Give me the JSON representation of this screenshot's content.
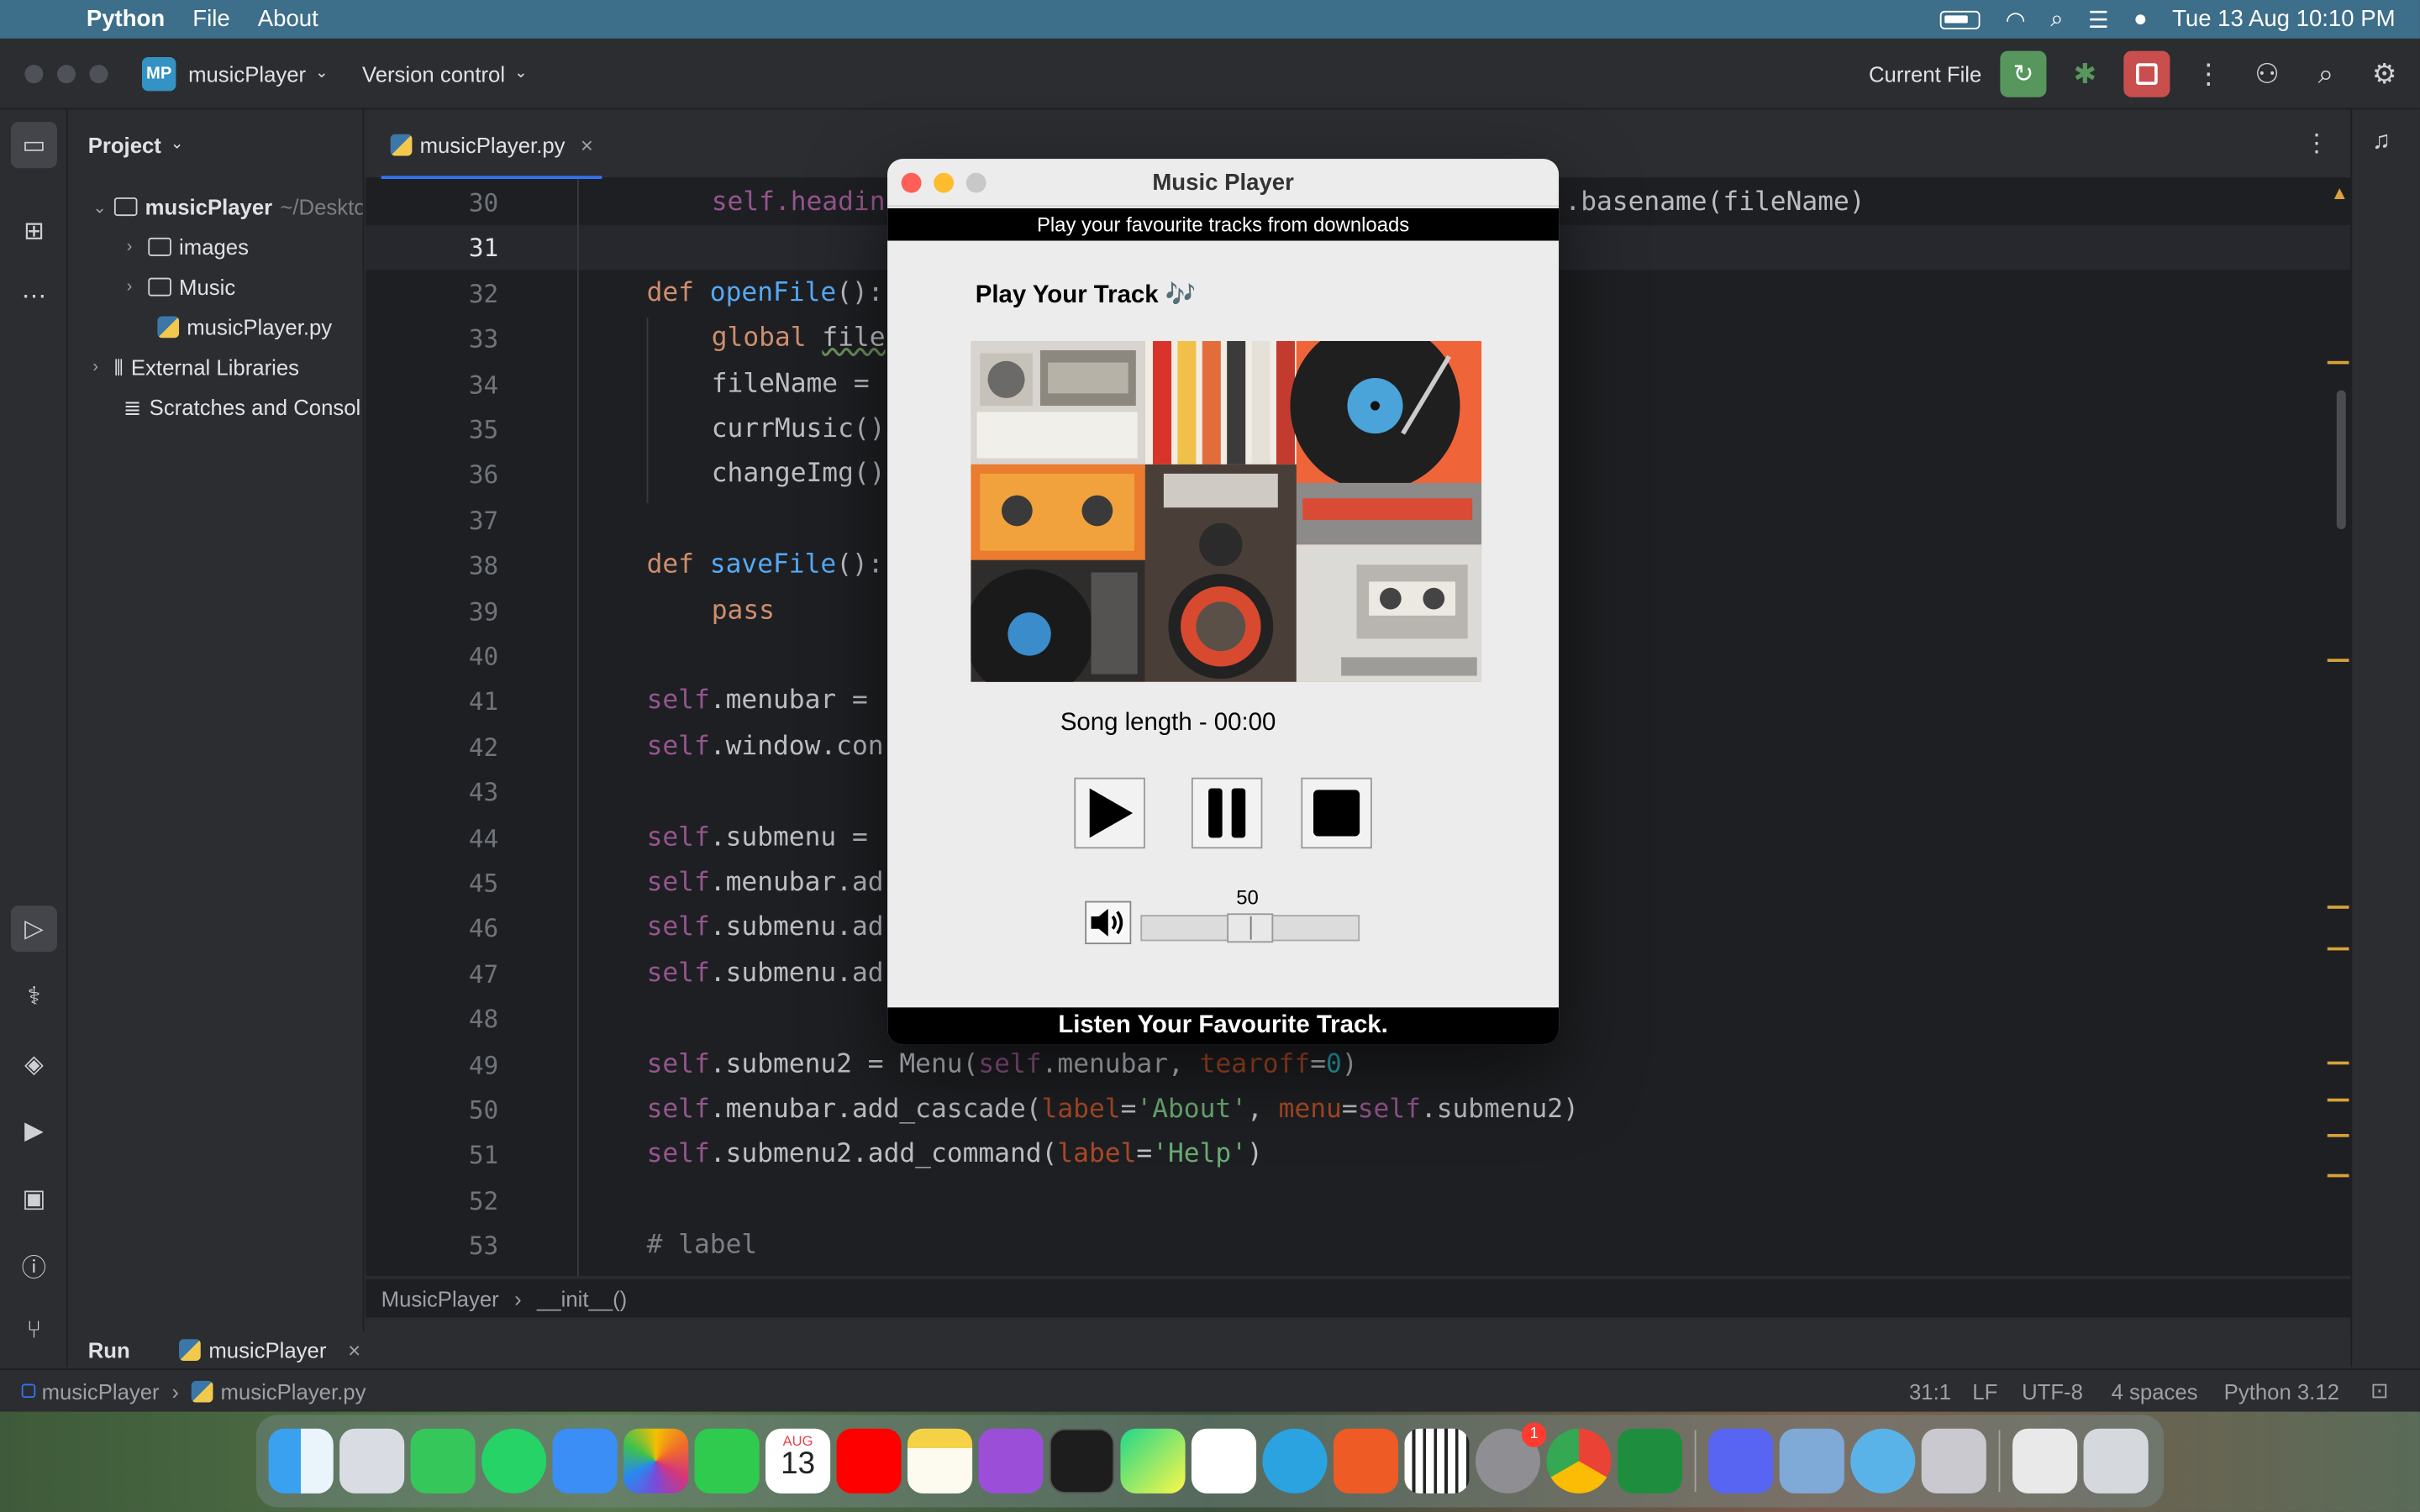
{
  "menubar": {
    "app": "Python",
    "items": [
      "File",
      "About"
    ],
    "datetime": "Tue 13 Aug  10:10 PM"
  },
  "titlebar": {
    "badge": "MP",
    "project": "musicPlayer",
    "vcs": "Version control",
    "run_config": "Current File"
  },
  "project_panel": {
    "title": "Project",
    "root": "musicPlayer",
    "root_path": "~/Deskto",
    "folders": [
      "images",
      "Music"
    ],
    "file": "musicPlayer.py",
    "ext_libs": "External Libraries",
    "scratches": "Scratches and Consol"
  },
  "editor": {
    "tab": "musicPlayer.py",
    "current_line": 31,
    "line_numbers": [
      "30",
      "31",
      "32",
      "33",
      "34",
      "35",
      "36",
      "37",
      "38",
      "39",
      "40",
      "41",
      "42",
      "43",
      "44",
      "45",
      "46",
      "47",
      "48",
      "49",
      "50",
      "51",
      "52",
      "53"
    ],
    "lines": {
      "l30a": "self.headin",
      "l30b": ".basename(fileName)",
      "l32a": "def ",
      "l32b": "openFile",
      "l32c": "():",
      "l33a": "global ",
      "l33b": "file",
      "l34": "fileName =",
      "l35": "currMusic()",
      "l36": "changeImg()",
      "l38a": "def ",
      "l38b": "saveFile",
      "l38c": "():",
      "l39": "pass",
      "l41a": "self",
      "l41b": ".menubar =",
      "l42a": "self",
      "l42b": ".window.con",
      "l44a": "self",
      "l44b": ".submenu =",
      "l45a": "self",
      "l45b": ".menubar.ad",
      "l46a": "self",
      "l46b": ".submenu.ad",
      "l47a": "self",
      "l47b": ".submenu.ad",
      "l49a": "self",
      "l49b": ".submenu2 = Menu(",
      "l49c": "self",
      "l49d": ".menubar, ",
      "l49e": "tearoff",
      "l49f": "=",
      "l49g": "0",
      "l49h": ")",
      "l50a": "self",
      "l50b": ".menubar.add_cascade(",
      "l50c": "label",
      "l50d": "=",
      "l50e": "'About'",
      "l50f": ", ",
      "l50g": "menu",
      "l50h": "=",
      "l50i": "self",
      "l50j": ".submenu2)",
      "l51a": "self",
      "l51b": ".submenu2.add_command(",
      "l51c": "label",
      "l51d": "=",
      "l51e": "'Help'",
      "l51f": ")",
      "l53": "# label"
    }
  },
  "breadcrumb": {
    "cls": "MusicPlayer",
    "method": "__init__()"
  },
  "runbar": {
    "label": "Run",
    "config": "musicPlayer"
  },
  "statusbar": {
    "path1": "musicPlayer",
    "path2": "musicPlayer.py",
    "position": "31:1",
    "line_sep": "LF",
    "encoding": "UTF-8",
    "indent": "4 spaces",
    "interpreter": "Python 3.12"
  },
  "player": {
    "title": "Music Player",
    "banner": "Play your favourite tracks from downloads",
    "heading": "Play Your Track 🎶",
    "song_length": "Song length - 00:00",
    "volume": "50",
    "volume_fraction": 0.5,
    "footer": "Listen Your Favourite Track."
  },
  "dock": {
    "calendar_month": "AUG",
    "calendar_day": "13",
    "settings_badge": "1"
  },
  "colors": {
    "accent": "#3574f0",
    "run_green": "#57965c",
    "stop_red": "#c94f4f",
    "mac_menubar": "#3d6e8a"
  }
}
